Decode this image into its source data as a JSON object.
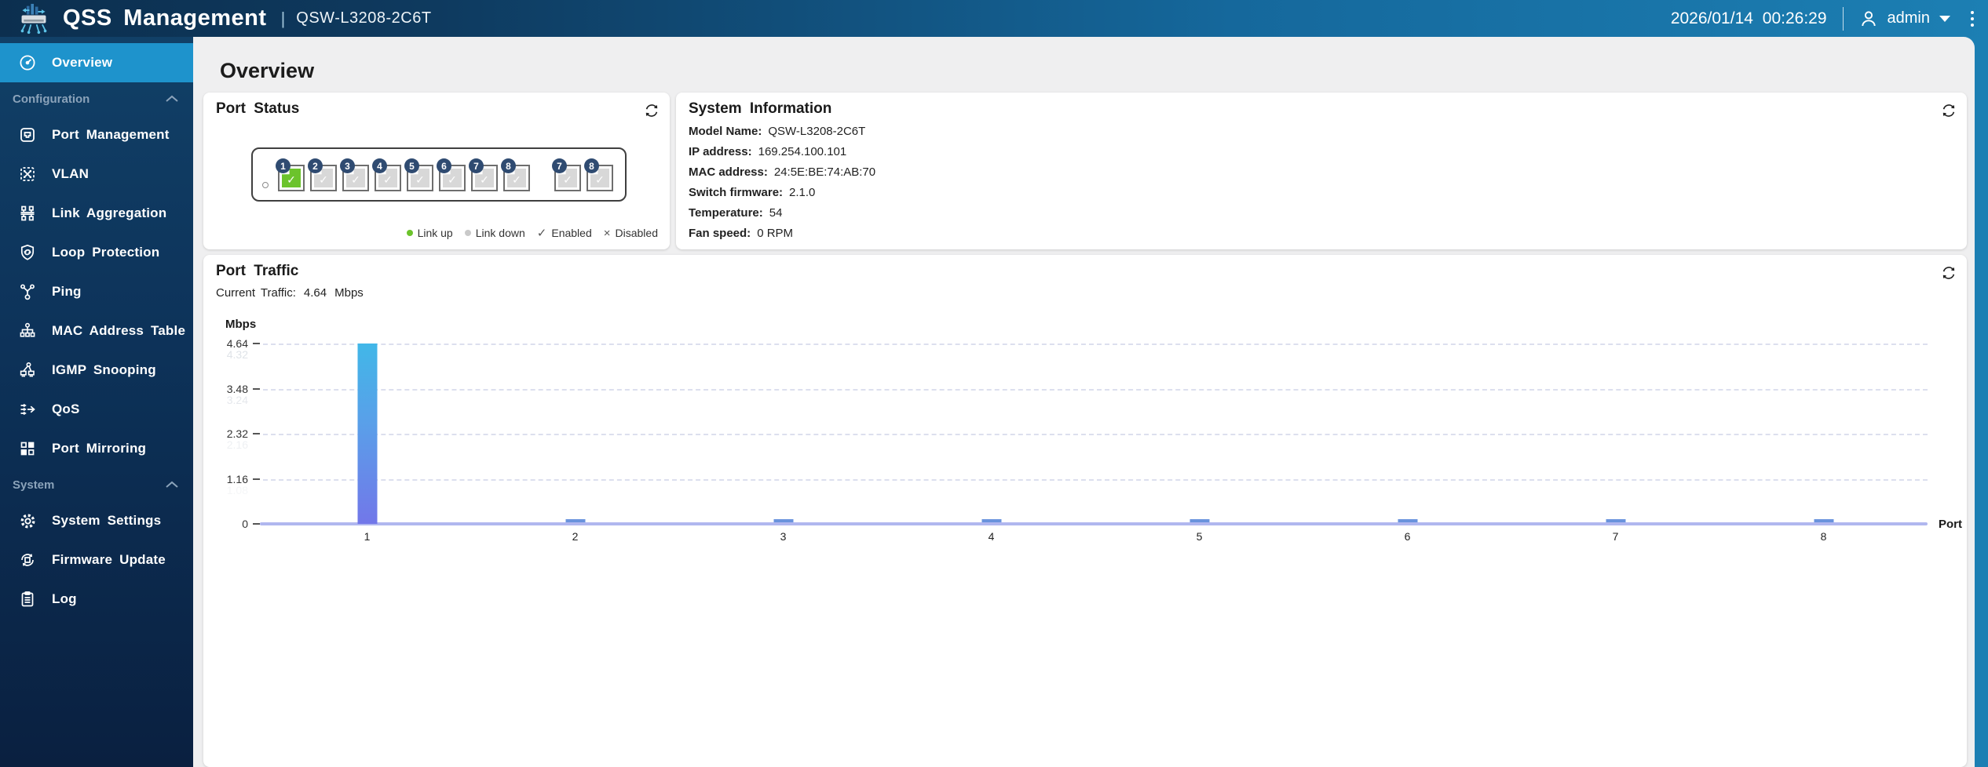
{
  "header": {
    "app_title": "QSS Management",
    "separator": "|",
    "device_model": "QSW-L3208-2C6T",
    "datetime": "2026/01/14 00:26:29",
    "user_name": "admin",
    "colors": {
      "gradient_start": "#0c2f4f",
      "gradient_end": "#1c7fb3"
    }
  },
  "sidebar": {
    "sections": [
      {
        "label": "Configuration"
      },
      {
        "label": "System"
      }
    ],
    "items": [
      {
        "label": "Overview",
        "icon": "gauge-icon",
        "active": true
      },
      {
        "label": "Port Management",
        "icon": "port-icon"
      },
      {
        "label": "VLAN",
        "icon": "vlan-icon"
      },
      {
        "label": "Link Aggregation",
        "icon": "link-aggregation-icon"
      },
      {
        "label": "Loop Protection",
        "icon": "shield-loop-icon"
      },
      {
        "label": "Ping",
        "icon": "ping-icon"
      },
      {
        "label": "MAC Address Table",
        "icon": "mac-table-icon"
      },
      {
        "label": "IGMP Snooping",
        "icon": "igmp-icon"
      },
      {
        "label": "QoS",
        "icon": "qos-icon"
      },
      {
        "label": "Port Mirroring",
        "icon": "mirror-icon"
      },
      {
        "label": "System Settings",
        "icon": "gear-icon"
      },
      {
        "label": "Firmware Update",
        "icon": "firmware-icon"
      },
      {
        "label": "Log",
        "icon": "log-icon"
      }
    ],
    "colors": {
      "background_top": "#114067",
      "background_bottom": "#0a2040",
      "active": "#1e93cc",
      "section_label": "#8ba3ba"
    }
  },
  "page": {
    "title": "Overview"
  },
  "port_status": {
    "title": "Port Status",
    "check_symbol": "✓",
    "cross_symbol": "×",
    "ports": [
      {
        "number": "1",
        "link": "up",
        "enabled": true
      },
      {
        "number": "2",
        "link": "down",
        "enabled": true
      },
      {
        "number": "3",
        "link": "down",
        "enabled": true
      },
      {
        "number": "4",
        "link": "down",
        "enabled": true
      },
      {
        "number": "5",
        "link": "down",
        "enabled": true
      },
      {
        "number": "6",
        "link": "down",
        "enabled": true
      },
      {
        "number": "7",
        "link": "down",
        "enabled": true
      },
      {
        "number": "8",
        "link": "down",
        "enabled": true
      },
      {
        "number": "7",
        "link": "down",
        "enabled": true,
        "combo": true
      },
      {
        "number": "8",
        "link": "down",
        "enabled": true,
        "combo": true
      }
    ],
    "legend": [
      {
        "type": "dot",
        "color": "#6cc32c",
        "label": "Link up"
      },
      {
        "type": "dot",
        "color": "#c9c9c9",
        "label": "Link down"
      },
      {
        "type": "symbol",
        "symbol": "✓",
        "label": "Enabled"
      },
      {
        "type": "symbol",
        "symbol": "×",
        "label": "Disabled"
      }
    ]
  },
  "system_information": {
    "title": "System Information",
    "rows": [
      {
        "label": "Model Name:",
        "value": "QSW-L3208-2C6T"
      },
      {
        "label": "IP address:",
        "value": "169.254.100.101"
      },
      {
        "label": "MAC address:",
        "value": "24:5E:BE:74:AB:70"
      },
      {
        "label": "Switch firmware:",
        "value": "2.1.0"
      },
      {
        "label": "Temperature:",
        "value": "54"
      },
      {
        "label": "Fan speed:",
        "value": "0 RPM"
      }
    ]
  },
  "port_traffic": {
    "title": "Port Traffic",
    "current_label": "Current Traffic:",
    "current_value": "4.64",
    "current_unit": "Mbps"
  },
  "chart_data": {
    "type": "bar",
    "title": "Port Traffic",
    "categories": [
      "1",
      "2",
      "3",
      "4",
      "5",
      "6",
      "7",
      "8"
    ],
    "values": [
      4.64,
      0.08,
      0.08,
      0.08,
      0.08,
      0.08,
      0.08,
      0.08
    ],
    "xlabel": "Port",
    "ylabel": "Mbps",
    "ylim": [
      0,
      4.64
    ],
    "yticks": [
      "4.64",
      "3.48",
      "2.32",
      "1.16",
      "0"
    ],
    "ghost_yticks": [
      "4.32",
      "3.24",
      "2.16",
      "1.08"
    ],
    "grid": "dashed horizontal",
    "legend_position": "none",
    "bar_gradient": [
      "#41b7e8",
      "#7277e9"
    ],
    "axis_color": "#b0b7ef"
  }
}
